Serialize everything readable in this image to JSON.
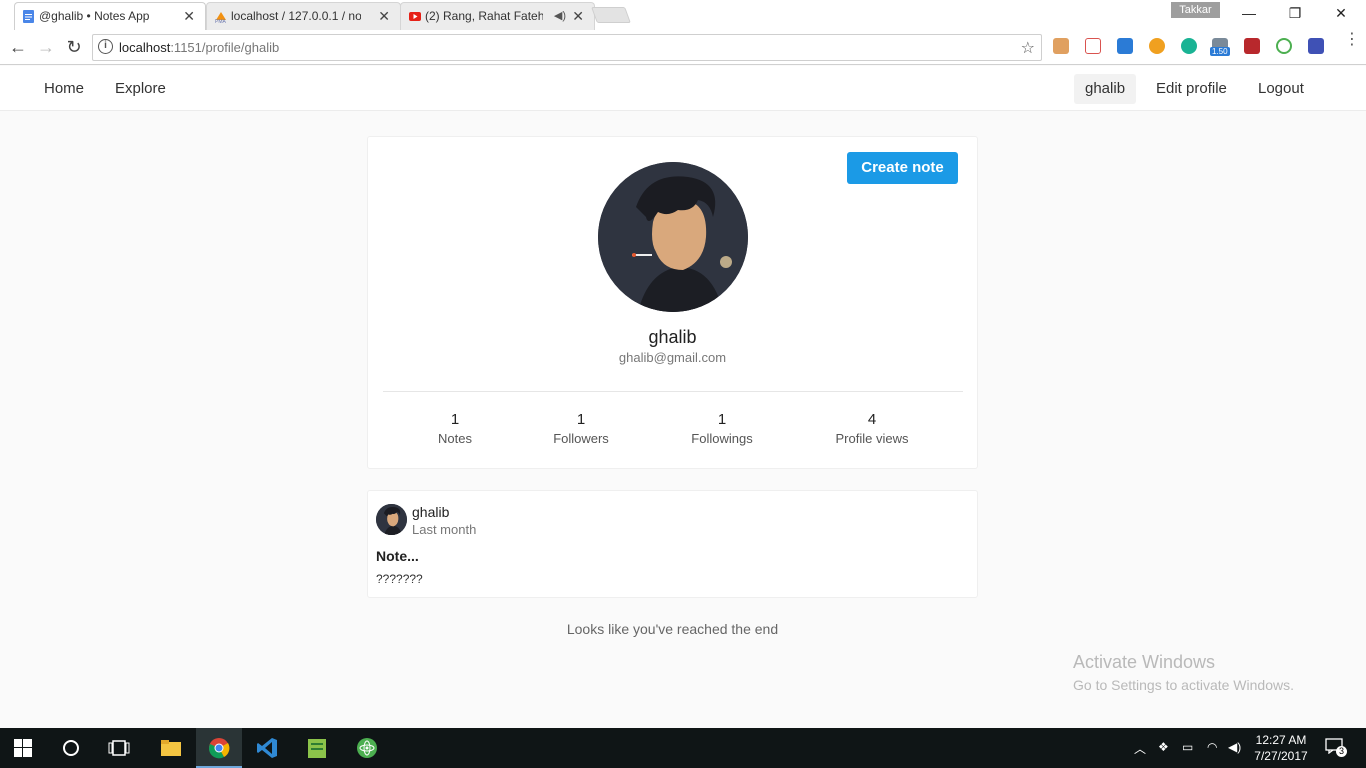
{
  "browser": {
    "tabs": [
      {
        "title": "@ghalib • Notes App",
        "active": true
      },
      {
        "title": "localhost / 127.0.0.1 / no",
        "active": false
      },
      {
        "title": "(2) Rang, Rahat Fateh",
        "active": false
      }
    ],
    "profile_chip": "Takkar",
    "url_host": "localhost",
    "url_path": ":1151/profile/ghalib",
    "extension_badge": "1.50"
  },
  "nav": {
    "home": "Home",
    "explore": "Explore",
    "username": "ghalib",
    "edit_profile": "Edit profile",
    "logout": "Logout"
  },
  "profile": {
    "create_note": "Create note",
    "name": "ghalib",
    "email": "ghalib@gmail.com",
    "stats": [
      {
        "value": "1",
        "label": "Notes"
      },
      {
        "value": "1",
        "label": "Followers"
      },
      {
        "value": "1",
        "label": "Followings"
      },
      {
        "value": "4",
        "label": "Profile views"
      }
    ]
  },
  "note": {
    "user": "ghalib",
    "time": "Last month",
    "title": "Note...",
    "body": "???????"
  },
  "end_message": "Looks like you've reached the end",
  "watermark": {
    "line1": "Activate Windows",
    "line2": "Go to Settings to activate Windows."
  },
  "taskbar": {
    "time": "12:27 AM",
    "date": "7/27/2017",
    "notifications": "3"
  },
  "colors": {
    "accent": "#1b9ae6"
  }
}
